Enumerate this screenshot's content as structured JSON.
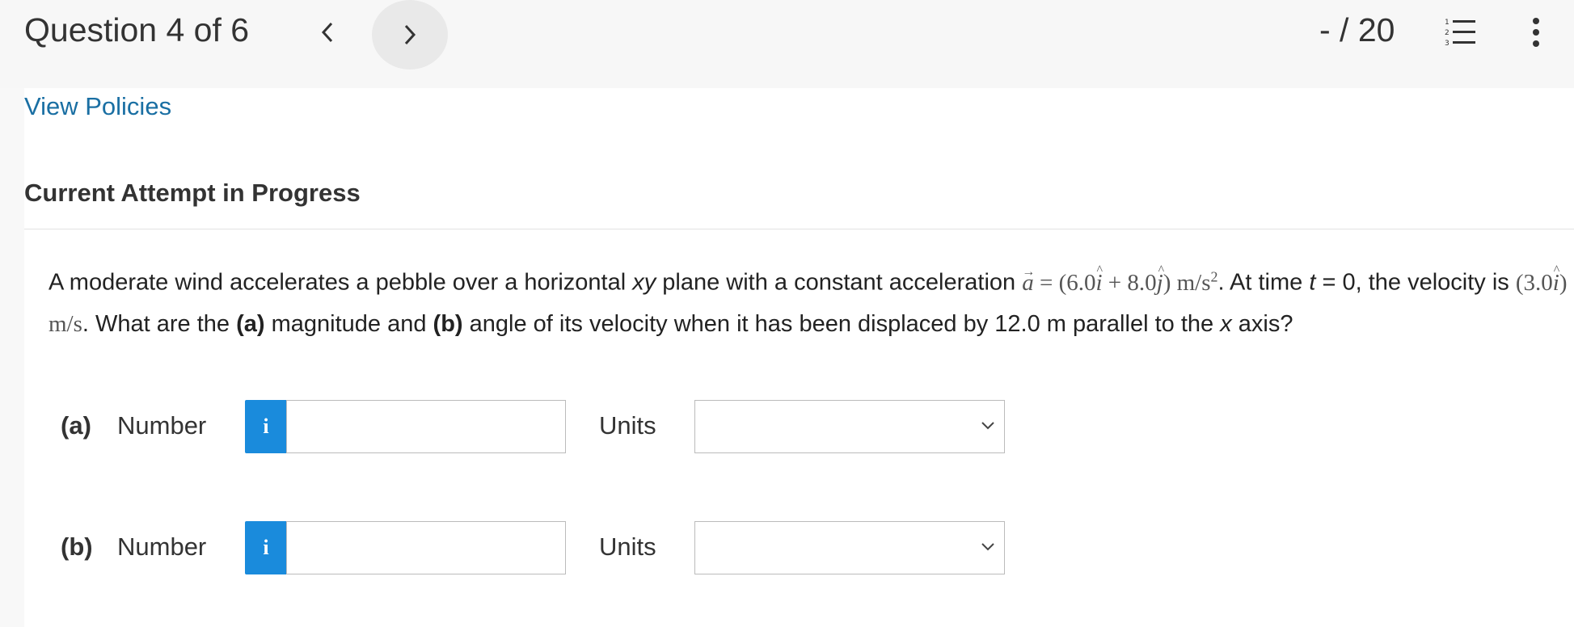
{
  "header": {
    "title": "Question 4 of 6",
    "score": "- / 20",
    "prev_icon": "chevron-left-icon",
    "next_icon": "chevron-right-icon",
    "list_icon": "numbered-list-icon",
    "more_icon": "more-vertical-icon"
  },
  "policies_link": "View Policies",
  "attempt_heading": "Current Attempt in Progress",
  "question": {
    "s1": "A moderate wind accelerates a pebble over a horizontal ",
    "s1_italic": "xy",
    "s2": " plane with a constant acceleration ",
    "accel_vec": "a",
    "accel_eq": " = (6.0",
    "i_hat": "i",
    "plus": " + 8.0",
    "j_hat": "j",
    "accel_unit": ") m/s",
    "exp": "2",
    "s3": ". At time ",
    "t_var": "t",
    "s4": " = 0, the velocity is ",
    "vel_open": "(3.0",
    "vel_i": "i",
    "vel_close": ") m/s",
    "s5": ". What are the ",
    "a_label": "(a)",
    "s6": " magnitude and ",
    "b_label": "(b)",
    "s7": " angle of its velocity when it has been displaced by 12.0 m parallel to the ",
    "x_var": "x",
    "s8": " axis?"
  },
  "answers": [
    {
      "part": "(a)",
      "number_label": "Number",
      "info": "i",
      "value": "",
      "placeholder": "",
      "units_label": "Units",
      "units_value": ""
    },
    {
      "part": "(b)",
      "number_label": "Number",
      "info": "i",
      "value": "",
      "placeholder": "",
      "units_label": "Units",
      "units_value": ""
    }
  ],
  "colors": {
    "link": "#1a6fa3",
    "info_button": "#1a8bdc"
  }
}
